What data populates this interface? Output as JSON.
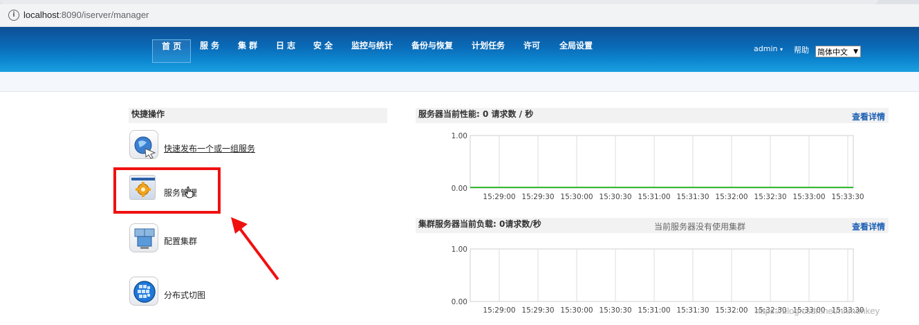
{
  "browser": {
    "url_host": "localhost",
    "url_rest": ":8090/iserver/manager"
  },
  "nav": {
    "items": [
      "首 页",
      "服 务",
      "集 群",
      "日 志",
      "安 全",
      "监控与统计",
      "备份与恢复",
      "计划任务",
      "许可",
      "全局设置"
    ],
    "user": "admin",
    "user_caret": "▾",
    "help": "帮助",
    "language": "简体中文"
  },
  "quick": {
    "title": "快捷操作",
    "items": [
      {
        "label": "快速发布一个或一组服务",
        "icon": "publish-globe-icon"
      },
      {
        "label": "服务管理",
        "icon": "service-gear-icon"
      },
      {
        "label": "配置集群",
        "icon": "cluster-computers-icon"
      },
      {
        "label": "分布式切图",
        "icon": "globe-tiles-icon"
      }
    ]
  },
  "perf": {
    "title": "服务器当前性能:  0 请求数 / 秒",
    "details": "查看详情"
  },
  "cluster": {
    "title": "集群服务器当前负载: 0请求数/秒",
    "note": "当前服务器没有使用集群",
    "details": "查看详情"
  },
  "chart_data": [
    {
      "type": "line",
      "x": [
        "15:29:00",
        "15:29:30",
        "15:30:00",
        "15:30:30",
        "15:31:00",
        "15:31:30",
        "15:32:00",
        "15:32:30",
        "15:33:00",
        "15:33:30"
      ],
      "yticks": [
        "1.00",
        "0.00"
      ],
      "ylim": [
        0,
        1
      ],
      "series": [
        {
          "values": [
            0,
            0,
            0,
            0,
            0,
            0,
            0,
            0,
            0,
            0
          ],
          "color": "#33bb33"
        }
      ]
    },
    {
      "type": "line",
      "x": [
        "15:29:00",
        "15:29:30",
        "15:30:00",
        "15:30:30",
        "15:31:00",
        "15:31:30",
        "15:32:00",
        "15:32:30",
        "15:33:00",
        "15:33:30"
      ],
      "yticks": [
        "1.00",
        "0.00"
      ],
      "ylim": [
        0,
        1
      ],
      "series": []
    }
  ],
  "watermark": "https://blog.csdn.net/hhmonkey",
  "colors": {
    "nav_top": "#0d4f94",
    "nav_bottom": "#1aa0e0",
    "highlight": "#f01010",
    "link": "#1a5fb4",
    "series": "#33bb33"
  }
}
